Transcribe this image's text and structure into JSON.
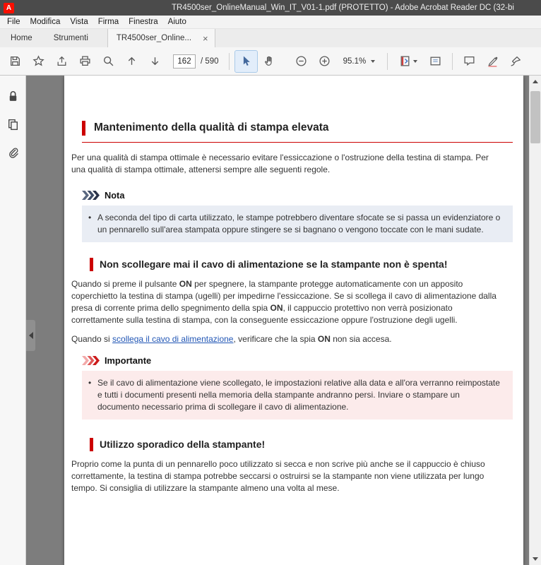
{
  "colors": {
    "titlebar_bg": "#4b4b4b",
    "adobe_red": "#fa0f00",
    "accent_red": "#cc0000",
    "note_bg": "#e9edf4",
    "important_bg": "#fcebeb",
    "link_blue": "#2156b5",
    "canvas_gray": "#7d7d7d"
  },
  "titlebar": {
    "app_icon_letter": "A",
    "title": "TR4500ser_OnlineManual_Win_IT_V01-1.pdf (PROTETTO) - Adobe Acrobat Reader DC (32-bi"
  },
  "menubar": {
    "items": [
      "File",
      "Modifica",
      "Vista",
      "Firma",
      "Finestra",
      "Aiuto"
    ]
  },
  "tabbar": {
    "home": "Home",
    "tools": "Strumenti",
    "document": "TR4500ser_Online...",
    "close": "×"
  },
  "toolbar": {
    "page_current": "162",
    "page_total": "/ 590",
    "zoom": "95.1%",
    "icons": [
      "save",
      "star",
      "share",
      "print",
      "search",
      "previous-page",
      "next-page",
      "selection-tool",
      "hand-tool",
      "zoom-out",
      "zoom-in",
      "page-display",
      "reading-mode",
      "comment",
      "highlight",
      "fill-sign"
    ]
  },
  "sidebar": {
    "icons": [
      "lock",
      "pages",
      "attachment"
    ]
  },
  "content": {
    "h1": "Mantenimento della qualità di stampa elevata",
    "p1": "Per una qualità di stampa ottimale è necessario evitare l'essiccazione o l'ostruzione della testina di stampa. Per una qualità di stampa ottimale, attenersi sempre alle seguenti regole.",
    "note_label": "Nota",
    "note_bullet": "•",
    "note_text": "A seconda del tipo di carta utilizzato, le stampe potrebbero diventare sfocate se si passa un evidenziatore o un pennarello sull'area stampata oppure stingere se si bagnano o vengono toccate con le mani sudate.",
    "h2": "Non scollegare mai il cavo di alimentazione se la stampante non è spenta!",
    "p2": {
      "s0": "Quando si preme il pulsante ",
      "s1": "ON",
      "s2": " per spegnere, la stampante protegge automaticamente con un apposito coperchietto la testina di stampa (ugelli) per impedirne l'essiccazione. Se si scollega il cavo di alimentazione dalla presa di corrente prima dello spegnimento della spia ",
      "s3": "ON",
      "s4": ", il cappuccio protettivo non verrà posizionato correttamente sulla testina di stampa, con la conseguente essiccazione oppure l'ostruzione degli ugelli."
    },
    "p3": {
      "s0": "Quando si ",
      "link": "scollega il cavo di alimentazione",
      "s1": ", verificare che la spia ",
      "s2": "ON",
      "s3": " non sia accesa."
    },
    "important_label": "Importante",
    "important_bullet": "•",
    "important_text": "Se il cavo di alimentazione viene scollegato, le impostazioni relative alla data e all'ora verranno reimpostate e tutti i documenti presenti nella memoria della stampante andranno persi. Inviare o stampare un documento necessario prima di scollegare il cavo di alimentazione.",
    "h3": "Utilizzo sporadico della stampante!",
    "p4": "Proprio come la punta di un pennarello poco utilizzato si secca e non scrive più anche se il cappuccio è chiuso correttamente, la testina di stampa potrebbe seccarsi o ostruirsi se la stampante non viene utilizzata per lungo tempo. Si consiglia di utilizzare la stampante almeno una volta al mese."
  }
}
